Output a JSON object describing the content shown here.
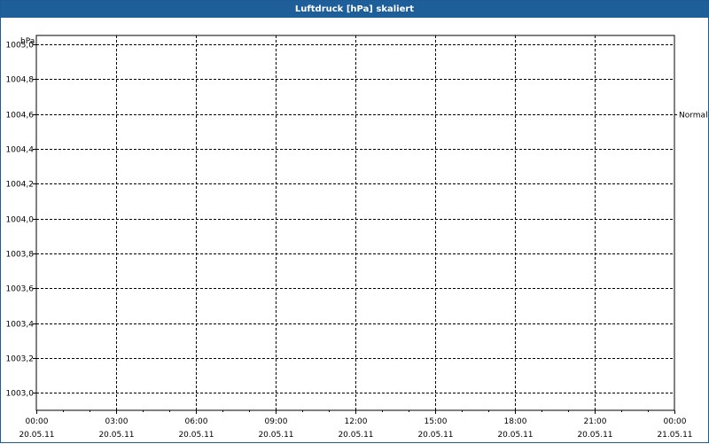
{
  "window": {
    "title": "Luftdruck [hPa] skaliert"
  },
  "chart_data": {
    "type": "line",
    "title": "Luftdruck [hPa] skaliert",
    "ylabel": "hPa",
    "xlabel": "",
    "ylim": [
      1002.9,
      1005.05
    ],
    "yticks": [
      "1005,0",
      "1004,8",
      "1004,6",
      "1004,4",
      "1004,2",
      "1004,0",
      "1003,8",
      "1003,6",
      "1003,4",
      "1003,2",
      "1003,0"
    ],
    "ytick_values": [
      1005.0,
      1004.8,
      1004.6,
      1004.4,
      1004.2,
      1004.0,
      1003.8,
      1003.6,
      1003.4,
      1003.2,
      1003.0
    ],
    "xticks": [
      {
        "time": "00:00",
        "date": "20.05.11"
      },
      {
        "time": "03:00",
        "date": "20.05.11"
      },
      {
        "time": "06:00",
        "date": "20.05.11"
      },
      {
        "time": "09:00",
        "date": "20.05.11"
      },
      {
        "time": "12:00",
        "date": "20.05.11"
      },
      {
        "time": "15:00",
        "date": "20.05.11"
      },
      {
        "time": "18:00",
        "date": "20.05.11"
      },
      {
        "time": "21:00",
        "date": "20.05.11"
      },
      {
        "time": "00:00",
        "date": "21.05.11"
      }
    ],
    "grid": true,
    "reference_lines": [
      {
        "label": "Normal",
        "value": 1004.6
      }
    ],
    "series": []
  }
}
